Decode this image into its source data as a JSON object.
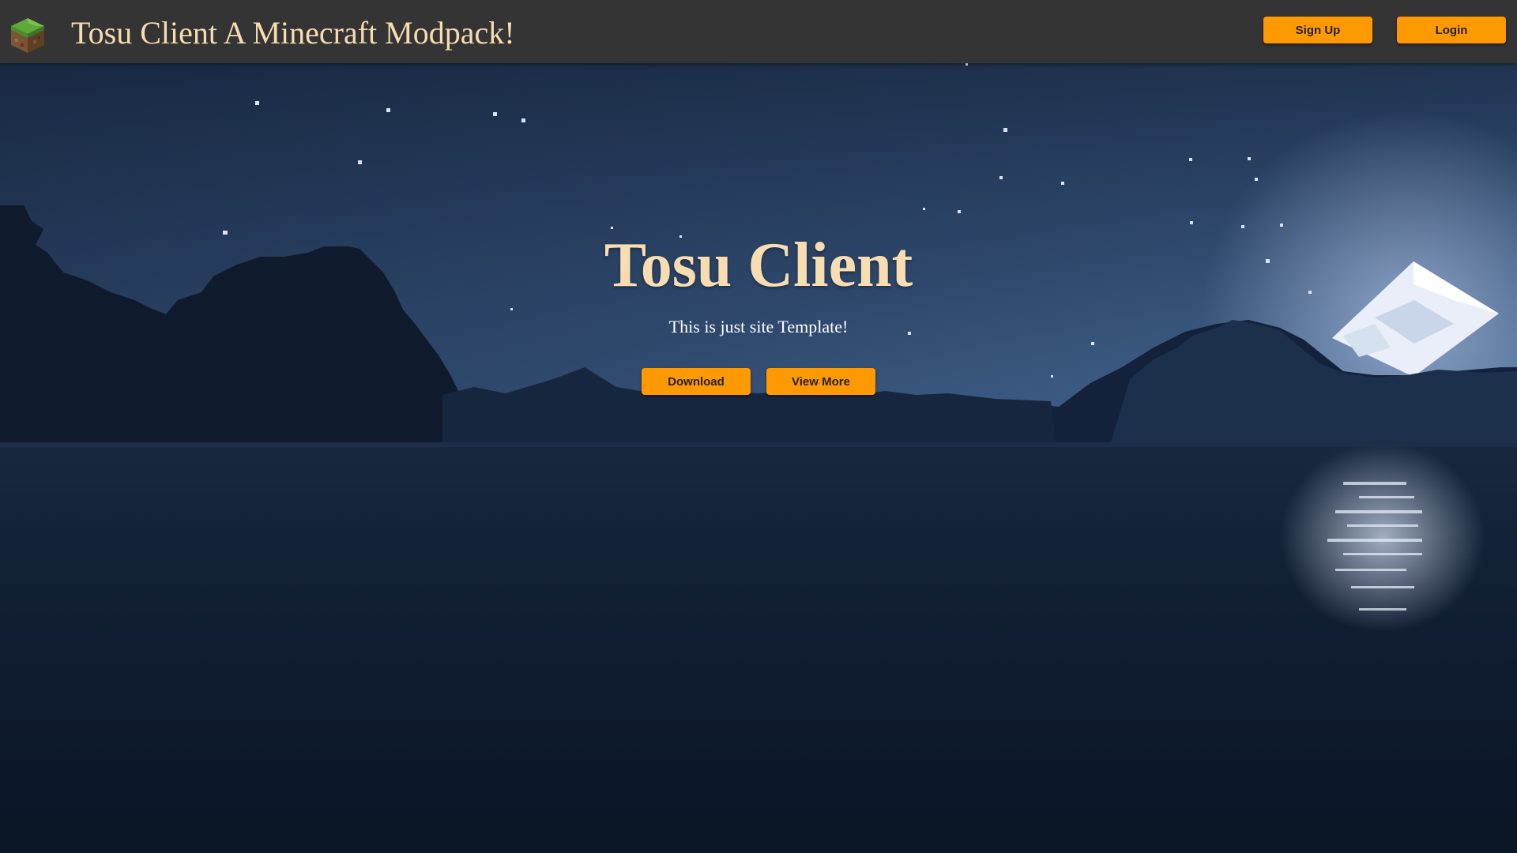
{
  "header": {
    "logo_icon": "grass-block-icon",
    "title": "Tosu Client A Minecraft Modpack!",
    "signup_label": "Sign Up",
    "login_label": "Login"
  },
  "hero": {
    "title": "Tosu Client",
    "subtitle": "This is just site Template!",
    "download_label": "Download",
    "view_more_label": "View More"
  },
  "background": {
    "scene_icon": "night-lake-moon-scene",
    "accent_color": "#ff9900",
    "title_color": "#f8dcb2"
  }
}
